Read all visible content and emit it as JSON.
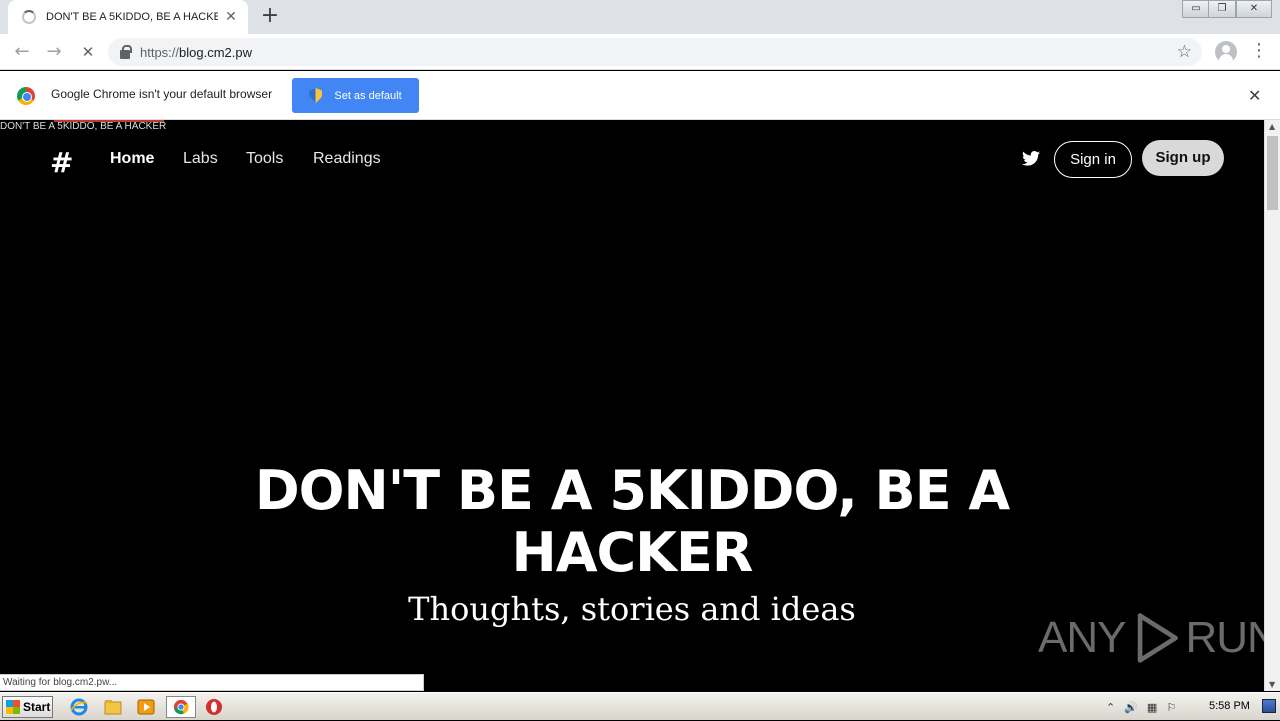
{
  "browser": {
    "tab_title": "DON'T BE A 5KIDDO, BE A HACKER",
    "tab_close": "✕",
    "new_tab": "+",
    "url_scheme": "https://",
    "url_host": "blog.cm2.pw",
    "back": "←",
    "forward": "→",
    "reload": "✕",
    "star": "☆",
    "menu": "⋮",
    "win_minimize": "▭",
    "win_restore": "❐",
    "win_close": "✕"
  },
  "infobar": {
    "message": "Google Chrome isn't your default browser",
    "button": "Set as default",
    "close": "✕"
  },
  "page": {
    "broken_image_alt": "DON'T BE A 5KIDDO, BE A HACKER",
    "logo": "#",
    "nav": [
      "Home",
      "Labs",
      "Tools",
      "Readings"
    ],
    "signin": "Sign in",
    "signup": "Sign up",
    "hero_title": "DON'T BE A 5KIDDO, BE A HACKER",
    "hero_subtitle": "Thoughts, stories and ideas",
    "watermark_left": "ANY",
    "watermark_right": "RUN"
  },
  "status": "Waiting for blog.cm2.pw...",
  "taskbar": {
    "start": "Start",
    "clock": "5:58 PM"
  }
}
